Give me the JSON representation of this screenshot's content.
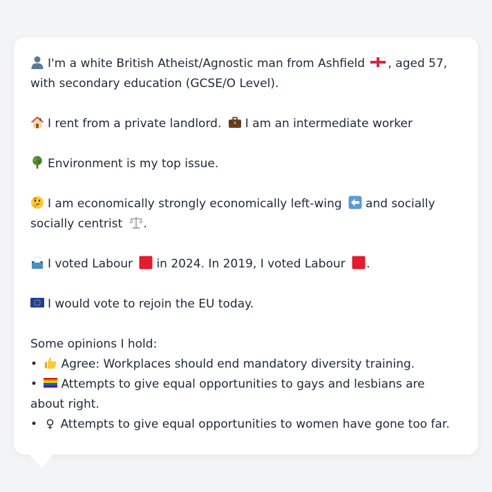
{
  "profile": {
    "identity_text_1": "I'm a white British Atheist/Agnostic man from Ashfield",
    "identity_text_2": ", aged 57, with secondary education (GCSE/O Level).",
    "housing_text_1": "I rent from a private landlord.",
    "housing_text_2": "I am an intermediate worker",
    "issue_text": "Environment is my top issue.",
    "politics_text_1": "I am economically strongly economically left-wing",
    "politics_text_2": "and socially socially centrist",
    "politics_text_3": ".",
    "vote_text_1": "I voted Labour",
    "vote_text_2": "in 2024. In 2019, I voted Labour",
    "vote_text_3": ".",
    "eu_text": "I would vote to rejoin the EU today."
  },
  "opinions": {
    "heading": "Some opinions I hold:",
    "bullet": "•",
    "items": [
      {
        "icon": "thumbs-up-icon",
        "text": "Agree: Workplaces should end mandatory diversity training."
      },
      {
        "icon": "rainbow-flag-icon",
        "text": "Attempts to give equal opportunities to gays and lesbians are about right."
      },
      {
        "icon": "female-sign-icon",
        "text": "Attempts to give equal opportunities to women have gone too far."
      }
    ],
    "female_symbol": "♀"
  },
  "colors": {
    "labour_red": "#e11d2e",
    "text": "#1f2937",
    "card_bg": "#ffffff",
    "page_bg": "#f3f4f6"
  }
}
